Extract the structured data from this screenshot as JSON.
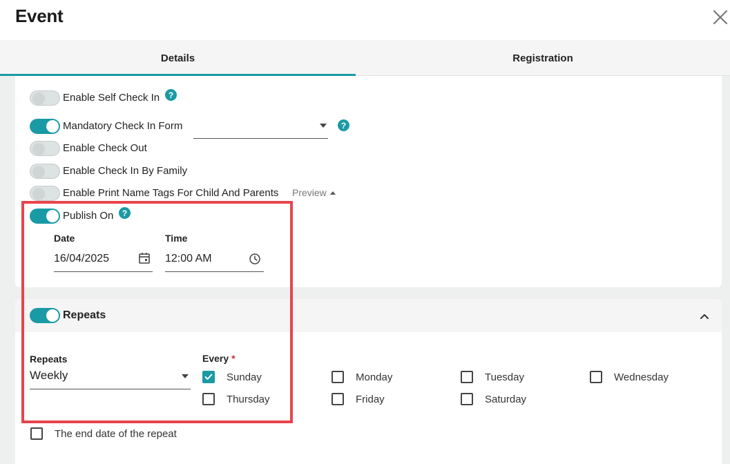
{
  "modal": {
    "title": "Event",
    "close_icon": "close-icon"
  },
  "tabs": [
    {
      "label": "Details",
      "active": true
    },
    {
      "label": "Registration",
      "active": false
    }
  ],
  "settings": {
    "self_check_in": {
      "label": "Enable Self Check In",
      "on": false
    },
    "mandatory_form": {
      "label": "Mandatory Check In Form",
      "on": true,
      "value": ""
    },
    "check_out": {
      "label": "Enable Check Out",
      "on": false
    },
    "check_in_family": {
      "label": "Enable Check In By Family",
      "on": false
    },
    "print_name_tags": {
      "label": "Enable Print Name Tags For Child And Parents",
      "on": false,
      "preview_label": "Preview"
    },
    "publish_on": {
      "label": "Publish On",
      "on": true
    }
  },
  "publish": {
    "date_label": "Date",
    "date_value": "16/04/2025",
    "time_label": "Time",
    "time_value": "12:00 AM"
  },
  "repeats_section": {
    "title": "Repeats",
    "on": true,
    "repeats_label": "Repeats",
    "repeats_value": "Weekly",
    "every_label": "Every",
    "required_mark": "*",
    "days": [
      {
        "label": "Sunday",
        "checked": true
      },
      {
        "label": "Monday",
        "checked": false
      },
      {
        "label": "Tuesday",
        "checked": false
      },
      {
        "label": "Wednesday",
        "checked": false
      },
      {
        "label": "Thursday",
        "checked": false
      },
      {
        "label": "Friday",
        "checked": false
      },
      {
        "label": "Saturday",
        "checked": false
      }
    ],
    "end_date_label": "The end date of the repeat"
  },
  "colors": {
    "accent": "#1a9aa5",
    "highlight": "#e8444c",
    "required": "#d32f2f"
  }
}
